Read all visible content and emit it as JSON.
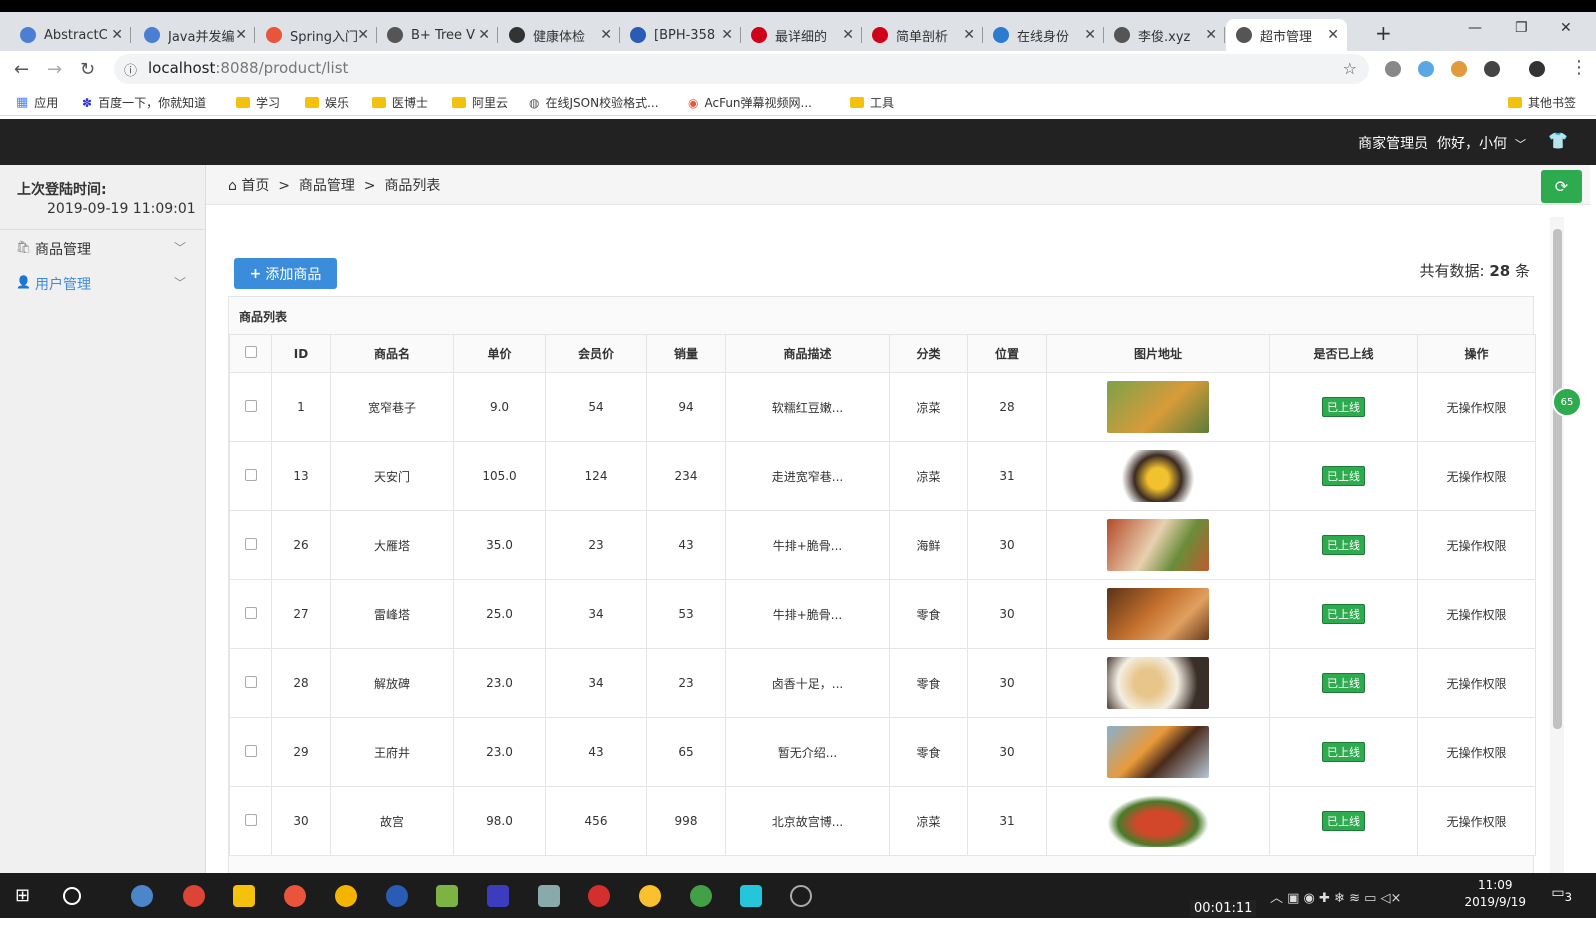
{
  "browser": {
    "tabs": [
      {
        "title": "AbstractC",
        "icon": "gear-icon",
        "color": "#4a7fd4"
      },
      {
        "title": "Java并发编",
        "icon": "gear-icon",
        "color": "#4a7fd4"
      },
      {
        "title": "Spring入门",
        "icon": "flame-icon",
        "color": "#e8553a"
      },
      {
        "title": "B+ Tree V",
        "icon": "globe-icon",
        "color": "#555"
      },
      {
        "title": "健康体检",
        "icon": "leaf-icon",
        "color": "#333"
      },
      {
        "title": "[BPH-358",
        "icon": "jira-icon",
        "color": "#2a5bb5"
      },
      {
        "title": "最详细的",
        "icon": "csdn-icon",
        "color": "#d0021b"
      },
      {
        "title": "简单剖析",
        "icon": "csdn-icon",
        "color": "#d0021b"
      },
      {
        "title": "在线身份",
        "icon": "doc-icon",
        "color": "#2a7bd1"
      },
      {
        "title": "李俊.xyz",
        "icon": "globe-icon",
        "color": "#555"
      },
      {
        "title": "超市管理",
        "icon": "globe-icon",
        "color": "#555"
      }
    ],
    "url_host": "localhost",
    "url_path": ":8088/product/list",
    "bookmarks": [
      "应用",
      "百度一下，你就知道",
      "学习",
      "娱乐",
      "医博士",
      "阿里云",
      "在线JSON校验格式...",
      "AcFun弹幕视频网...",
      "工具",
      "其他书签"
    ]
  },
  "header": {
    "role": "商家管理员",
    "greeting": "你好，小何"
  },
  "sidebar": {
    "last_login_label": "上次登陆时间:",
    "last_login_time": "2019-09-19 11:09:01",
    "items": [
      {
        "label": "商品管理"
      },
      {
        "label": "用户管理"
      }
    ]
  },
  "breadcrumb": {
    "home": "首页",
    "sep": ">",
    "level1": "商品管理",
    "level2": "商品列表"
  },
  "toolbar": {
    "add_label": "添加商品",
    "total_prefix": "共有数据:",
    "total_count": "28",
    "total_suffix": "条"
  },
  "table": {
    "title": "商品列表",
    "columns": [
      "ID",
      "商品名",
      "单价",
      "会员价",
      "销量",
      "商品描述",
      "分类",
      "位置",
      "图片地址",
      "是否已上线",
      "操作"
    ],
    "rows": [
      {
        "id": "1",
        "name": "宽窄巷子",
        "price": "9.0",
        "member": "54",
        "sales": "94",
        "desc": "软糯红豆嫩...",
        "cat": "凉菜",
        "pos": "28",
        "img": "drink-thumb",
        "status": "已上线",
        "op": "无操作权限"
      },
      {
        "id": "13",
        "name": "天安门",
        "price": "105.0",
        "member": "124",
        "sales": "234",
        "desc": "走进宽窄巷...",
        "cat": "凉菜",
        "pos": "31",
        "img": "dessert-thumb",
        "status": "已上线",
        "op": "无操作权限"
      },
      {
        "id": "26",
        "name": "大雁塔",
        "price": "35.0",
        "member": "23",
        "sales": "43",
        "desc": "牛排+脆骨...",
        "cat": "海鲜",
        "pos": "30",
        "img": "dishes-thumb",
        "status": "已上线",
        "op": "无操作权限"
      },
      {
        "id": "27",
        "name": "雷峰塔",
        "price": "25.0",
        "member": "34",
        "sales": "53",
        "desc": "牛排+脆骨...",
        "cat": "零食",
        "pos": "30",
        "img": "pizza-thumb",
        "status": "已上线",
        "op": "无操作权限"
      },
      {
        "id": "28",
        "name": "解放碑",
        "price": "23.0",
        "member": "34",
        "sales": "23",
        "desc": "卤香十足，...",
        "cat": "零食",
        "pos": "30",
        "img": "plate-thumb",
        "status": "已上线",
        "op": "无操作权限"
      },
      {
        "id": "29",
        "name": "王府井",
        "price": "23.0",
        "member": "43",
        "sales": "65",
        "desc": "暂无介绍...",
        "cat": "零食",
        "pos": "30",
        "img": "cake-thumb",
        "status": "已上线",
        "op": "无操作权限"
      },
      {
        "id": "30",
        "name": "故宫",
        "price": "98.0",
        "member": "456",
        "sales": "998",
        "desc": "北京故宫博...",
        "cat": "凉菜",
        "pos": "31",
        "img": "crayfish-thumb",
        "status": "已上线",
        "op": "无操作权限"
      }
    ]
  },
  "side_bubble": "65",
  "taskbar": {
    "time": "11:09",
    "date": "2019/9/19",
    "notifications": "3",
    "recording_timer": "00:01:11"
  }
}
